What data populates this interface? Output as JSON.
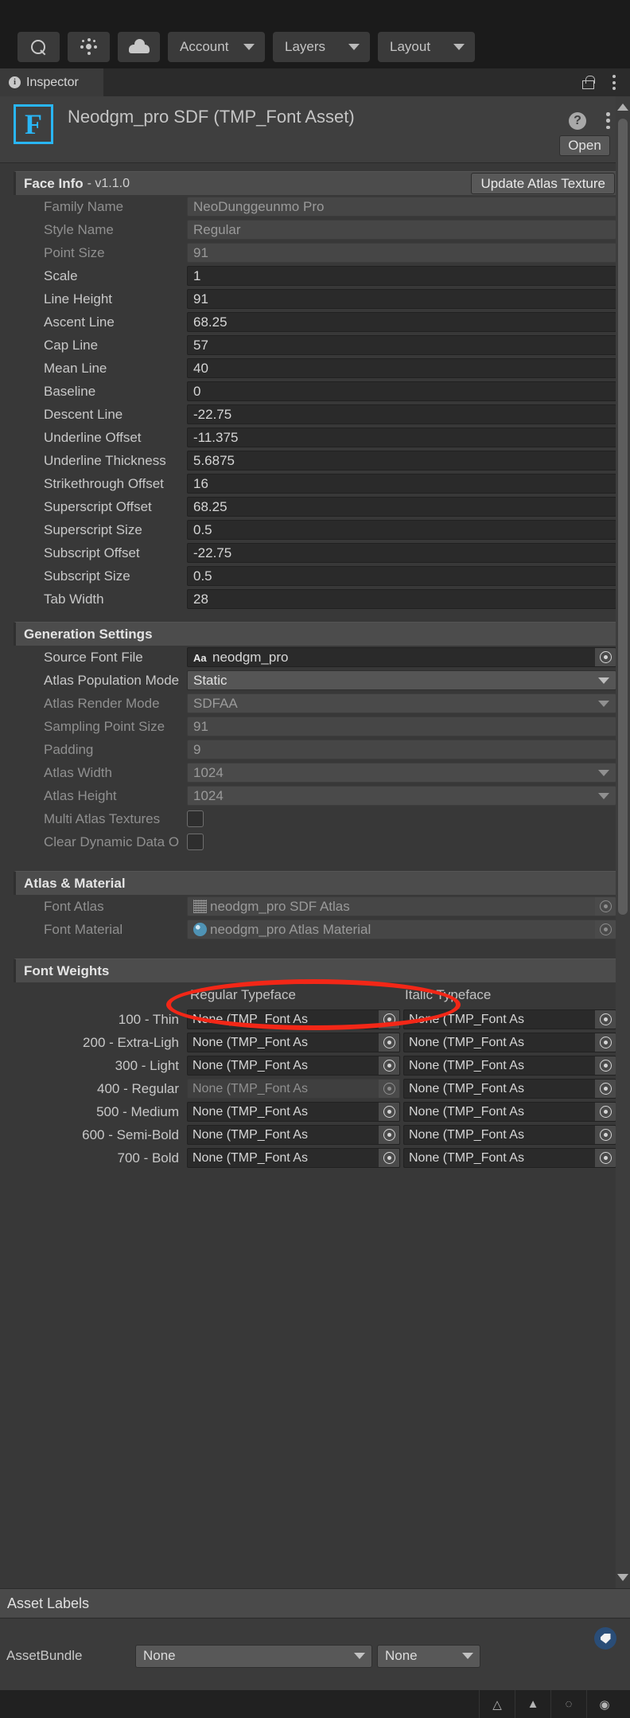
{
  "toolbar": {
    "search_icon": "search-icon",
    "gear_icon": "gear-icon",
    "cloud_icon": "cloud-icon",
    "account_label": "Account",
    "layers_label": "Layers",
    "layout_label": "Layout"
  },
  "tabbar": {
    "inspector_tab": "Inspector",
    "info_badge": "i",
    "lock_icon": "lock-open-icon",
    "menu_icon": "kebab-menu-icon"
  },
  "asset_header": {
    "icon_letter": "F",
    "title": "Neodgm_pro SDF (TMP_Font Asset)",
    "help_label": "?",
    "open_button": "Open"
  },
  "face_info": {
    "header_title": "Face Info",
    "header_version": "- v1.1.0",
    "update_button": "Update Atlas Texture",
    "rows": [
      {
        "label": "Family Name",
        "value": "NeoDunggeunmo Pro",
        "disabled": true
      },
      {
        "label": "Style Name",
        "value": "Regular",
        "disabled": true
      },
      {
        "label": "Point Size",
        "value": "91",
        "disabled": true
      },
      {
        "label": "Scale",
        "value": "1",
        "disabled": false
      },
      {
        "label": "Line Height",
        "value": "91",
        "disabled": false
      },
      {
        "label": "Ascent Line",
        "value": "68.25",
        "disabled": false
      },
      {
        "label": "Cap Line",
        "value": "57",
        "disabled": false
      },
      {
        "label": "Mean Line",
        "value": "40",
        "disabled": false
      },
      {
        "label": "Baseline",
        "value": "0",
        "disabled": false
      },
      {
        "label": "Descent Line",
        "value": "-22.75",
        "disabled": false
      },
      {
        "label": "Underline Offset",
        "value": "-11.375",
        "disabled": false
      },
      {
        "label": "Underline Thickness",
        "value": "5.6875",
        "disabled": false
      },
      {
        "label": "Strikethrough Offset",
        "value": "16",
        "disabled": false
      },
      {
        "label": "Superscript Offset",
        "value": "68.25",
        "disabled": false
      },
      {
        "label": "Superscript Size",
        "value": "0.5",
        "disabled": false
      },
      {
        "label": "Subscript Offset",
        "value": "-22.75",
        "disabled": false
      },
      {
        "label": "Subscript Size",
        "value": "0.5",
        "disabled": false
      },
      {
        "label": "Tab Width",
        "value": "28",
        "disabled": false
      }
    ]
  },
  "generation_settings": {
    "header_title": "Generation Settings",
    "source_font_file": {
      "label": "Source Font File",
      "value": "neodgm_pro",
      "icon": "aa-font-icon"
    },
    "atlas_population_mode": {
      "label": "Atlas Population Mode",
      "value": "Static"
    },
    "atlas_render_mode": {
      "label": "Atlas Render Mode",
      "value": "SDFAA"
    },
    "sampling_point_size": {
      "label": "Sampling Point Size",
      "value": "91"
    },
    "padding": {
      "label": "Padding",
      "value": "9"
    },
    "atlas_width": {
      "label": "Atlas Width",
      "value": "1024"
    },
    "atlas_height": {
      "label": "Atlas Height",
      "value": "1024"
    },
    "multi_atlas_textures": {
      "label": "Multi Atlas Textures",
      "checked": false
    },
    "clear_dynamic_data": {
      "label": "Clear Dynamic Data O",
      "checked": false
    }
  },
  "atlas_material": {
    "header_title": "Atlas & Material",
    "font_atlas": {
      "label": "Font Atlas",
      "value": "neodgm_pro SDF Atlas",
      "icon": "texture-icon"
    },
    "font_material": {
      "label": "Font Material",
      "value": "neodgm_pro Atlas Material",
      "icon": "material-sphere-icon"
    }
  },
  "font_weights": {
    "header_title": "Font Weights",
    "col_regular": "Regular Typeface",
    "col_italic": "Italic Typeface",
    "placeholder": "None (TMP_Font As",
    "rows": [
      {
        "weight": "100 - Thin",
        "regular_disabled": false
      },
      {
        "weight": "200 - Extra-Ligh",
        "regular_disabled": false
      },
      {
        "weight": "300 - Light",
        "regular_disabled": false
      },
      {
        "weight": "400 - Regular",
        "regular_disabled": true
      },
      {
        "weight": "500 - Medium",
        "regular_disabled": false
      },
      {
        "weight": "600 - Semi-Bold",
        "regular_disabled": false
      },
      {
        "weight": "700 - Bold",
        "regular_disabled": false
      }
    ]
  },
  "asset_labels": {
    "header_title": "Asset Labels",
    "tag_icon": "tag-icon",
    "assetbundle_label": "AssetBundle",
    "assetbundle_value": "None",
    "variant_value": "None"
  },
  "annotation": {
    "shape": "red-ellipse-highlight",
    "color": "#f32717",
    "target": "atlas-population-mode-dropdown"
  },
  "scrollbar": {
    "name": "vertical-scrollbar"
  },
  "status_icons": [
    "mesh-icon",
    "mesh-filled-icon",
    "no-light-icon",
    "audio-icon"
  ]
}
